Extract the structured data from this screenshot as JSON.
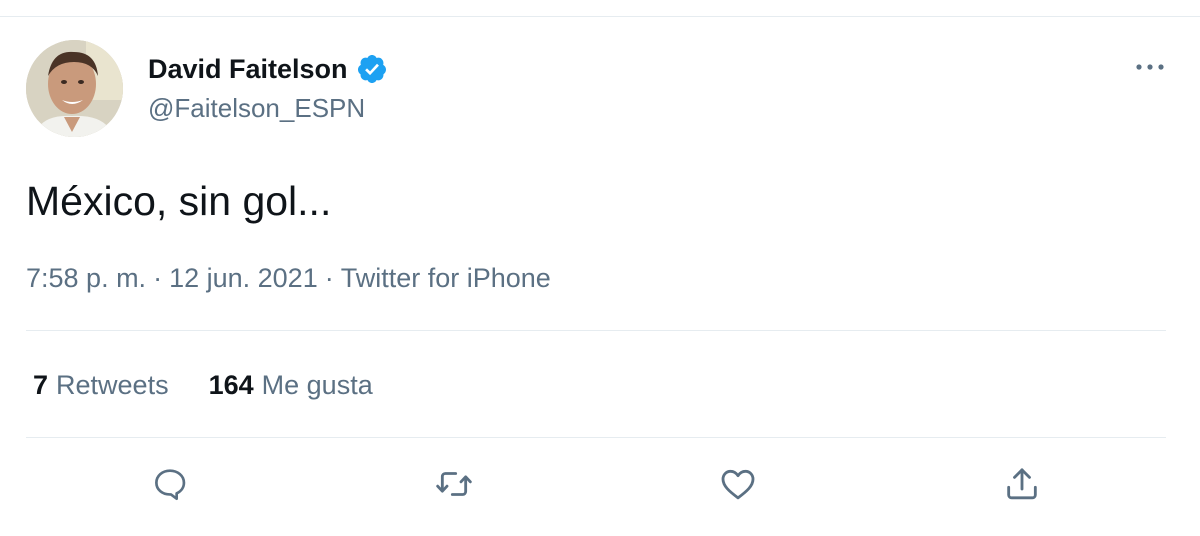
{
  "tweet": {
    "author": {
      "display_name": "David Faitelson",
      "handle": "@Faitelson_ESPN",
      "verified": true
    },
    "text": "México, sin gol...",
    "meta": {
      "time": "7:58 p. m.",
      "separator": "·",
      "date": "12 jun. 2021",
      "source": "Twitter for iPhone"
    },
    "stats": {
      "retweets_count": "7",
      "retweets_label": "Retweets",
      "likes_count": "164",
      "likes_label": "Me gusta"
    },
    "actions": {
      "icons": [
        "reply-icon",
        "retweet-icon",
        "like-icon",
        "share-icon"
      ]
    }
  },
  "colors": {
    "text_primary": "#0f1419",
    "text_secondary": "#5b7083",
    "divider": "#e6ecf0",
    "verified": "#1da1f2",
    "icon": "#5b7083"
  }
}
